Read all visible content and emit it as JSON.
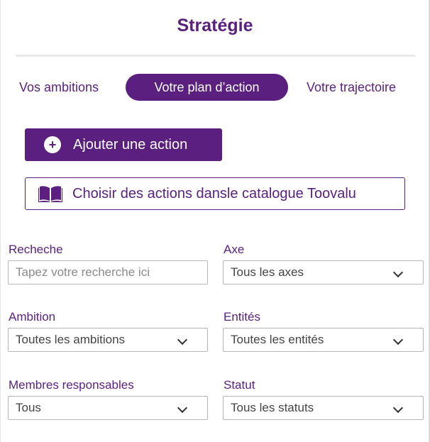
{
  "header": {
    "title": "Stratégie"
  },
  "tabs": [
    {
      "label": "Vos ambitions",
      "active": false
    },
    {
      "label": "Votre plan d’action",
      "active": true
    },
    {
      "label": "Votre trajectoire",
      "active": false
    }
  ],
  "actions": {
    "add_label": "Ajouter une action",
    "add_icon": "plus-circle-icon",
    "catalog_label": "Choisir des actions dansle catalogue Toovalu",
    "catalog_icon": "open-book-icon"
  },
  "filters": {
    "search": {
      "label": "Recheche",
      "placeholder": "Tapez votre recherche ici",
      "value": ""
    },
    "axe": {
      "label": "Axe",
      "value": "Tous les axes"
    },
    "ambition": {
      "label": "Ambition",
      "value": "Toutes les ambitions"
    },
    "entites": {
      "label": "Entités",
      "value": "Toutes les entités"
    },
    "membres": {
      "label": "Membres responsables",
      "value": "Tous"
    },
    "statut": {
      "label": "Statut",
      "value": "Tous les statuts"
    }
  },
  "colors": {
    "brand": "#5b1f7f",
    "text": "#444444",
    "border": "#b5b5b5"
  }
}
